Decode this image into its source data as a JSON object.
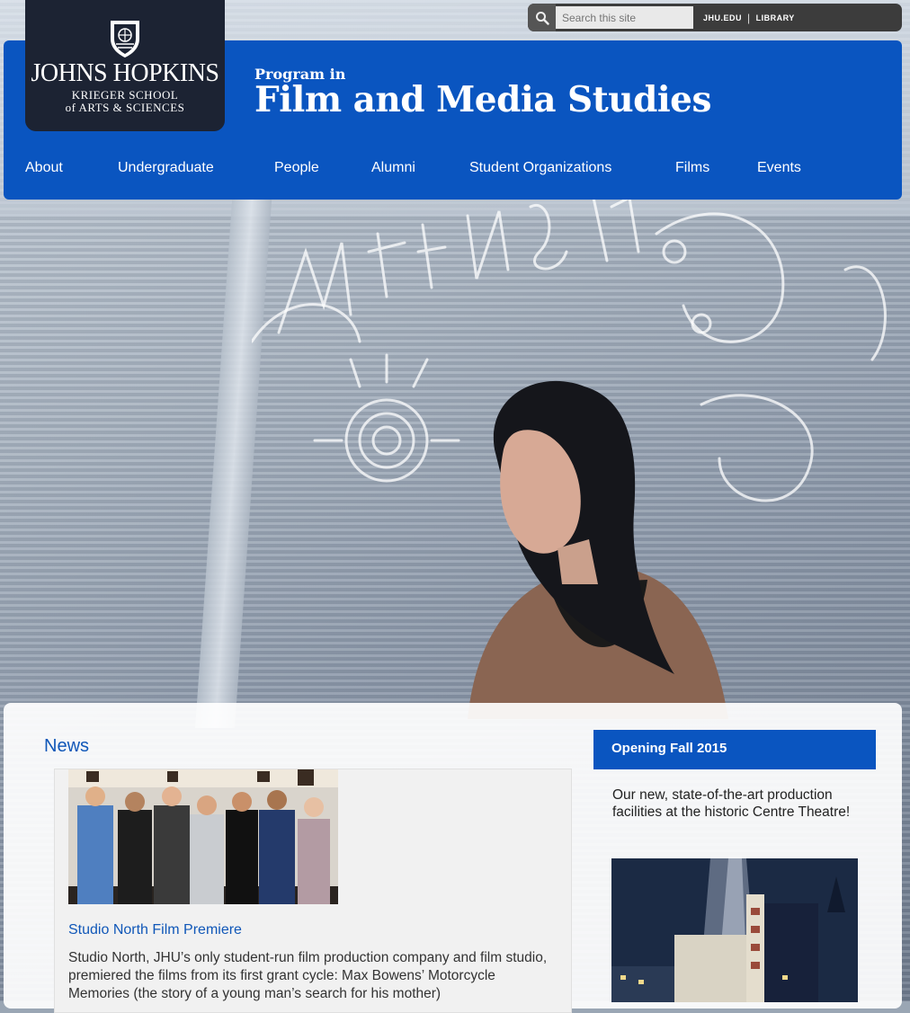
{
  "search": {
    "placeholder": "Search this site"
  },
  "top_links": [
    {
      "label": "JHU.EDU"
    },
    {
      "label": "LIBRARY"
    }
  ],
  "logo": {
    "line1": "JOHNS HOPKINS",
    "line2": "KRIEGER SCHOOL",
    "line3": "of ARTS & SCIENCES"
  },
  "header": {
    "program": "Program in",
    "title": "Film and Media Studies"
  },
  "nav": [
    {
      "label": "About"
    },
    {
      "label": "Undergraduate"
    },
    {
      "label": "People"
    },
    {
      "label": "Alumni"
    },
    {
      "label": "Student Organizations"
    },
    {
      "label": "Films"
    },
    {
      "label": "Events"
    }
  ],
  "news": {
    "heading": "News",
    "item_title": "Studio North Film Premiere",
    "item_body": "Studio North, JHU’s only student-run film production company and film studio, premiered the films from its first grant cycle: Max Bowens’ Motorcycle Memories (the story of a young man’s search for his mother)"
  },
  "sidebar": {
    "heading": "Opening Fall 2015",
    "body": "Our new, state-of-the-art production facilities at the historic Centre Theatre!"
  },
  "colors": {
    "brand_blue": "#0a55c0",
    "logo_navy": "#1c2333",
    "link_blue": "#1057b8"
  }
}
